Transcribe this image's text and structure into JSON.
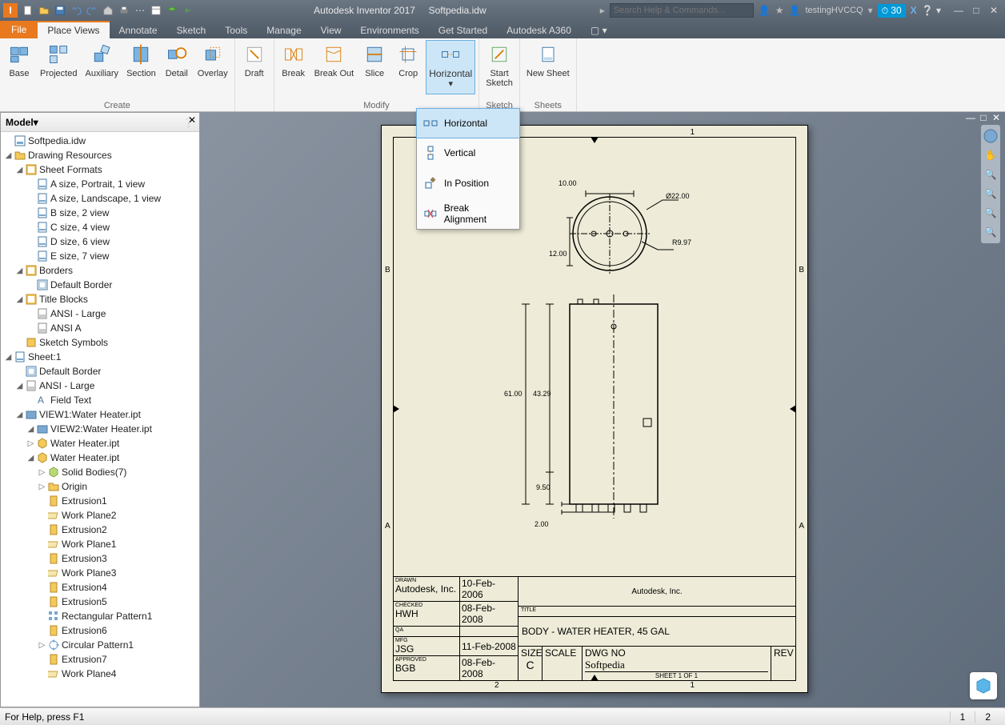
{
  "app": {
    "title": "Autodesk Inventor 2017",
    "doc": "Softpedia.idw"
  },
  "search_placeholder": "Search Help & Commands...",
  "user": "testingHVCCQ",
  "badge": "30",
  "menus": {
    "file": "File",
    "place_views": "Place Views",
    "annotate": "Annotate",
    "sketch": "Sketch",
    "tools": "Tools",
    "manage": "Manage",
    "view": "View",
    "environments": "Environments",
    "get_started": "Get Started",
    "a360": "Autodesk A360"
  },
  "ribbon": {
    "create": {
      "label": "Create",
      "base": "Base",
      "projected": "Projected",
      "auxiliary": "Auxiliary",
      "section": "Section",
      "detail": "Detail",
      "overlay": "Overlay",
      "draft": "Draft"
    },
    "modify": {
      "label": "Modify",
      "break": "Break",
      "break_out": "Break Out",
      "slice": "Slice",
      "crop": "Crop",
      "horizontal": "Horizontal"
    },
    "sketch": {
      "label": "Sketch",
      "start": "Start\nSketch"
    },
    "sheets": {
      "label": "Sheets",
      "new": "New Sheet"
    }
  },
  "dropdown": {
    "horizontal": "Horizontal",
    "vertical": "Vertical",
    "in_position": "In Position",
    "break_alignment": "Break Alignment"
  },
  "model": {
    "title": "Model"
  },
  "tree": [
    {
      "l": 0,
      "t": "",
      "i": "idw",
      "txt": "Softpedia.idw"
    },
    {
      "l": 0,
      "t": "▢",
      "i": "fld",
      "txt": "Drawing Resources"
    },
    {
      "l": 1,
      "t": "▢",
      "i": "shf",
      "txt": "Sheet Formats"
    },
    {
      "l": 2,
      "t": "",
      "i": "sht",
      "txt": "A size, Portrait, 1 view"
    },
    {
      "l": 2,
      "t": "",
      "i": "sht",
      "txt": "A size, Landscape, 1 view"
    },
    {
      "l": 2,
      "t": "",
      "i": "sht",
      "txt": "B size, 2 view"
    },
    {
      "l": 2,
      "t": "",
      "i": "sht",
      "txt": "C size, 4 view"
    },
    {
      "l": 2,
      "t": "",
      "i": "sht",
      "txt": "D size, 6 view"
    },
    {
      "l": 2,
      "t": "",
      "i": "sht",
      "txt": "E size, 7 view"
    },
    {
      "l": 1,
      "t": "▢",
      "i": "shf",
      "txt": "Borders"
    },
    {
      "l": 2,
      "t": "",
      "i": "brd",
      "txt": "Default Border"
    },
    {
      "l": 1,
      "t": "▢",
      "i": "shf",
      "txt": "Title Blocks"
    },
    {
      "l": 2,
      "t": "",
      "i": "ttl",
      "txt": "ANSI - Large"
    },
    {
      "l": 2,
      "t": "",
      "i": "ttl",
      "txt": "ANSI A"
    },
    {
      "l": 1,
      "t": "",
      "i": "sks",
      "txt": "Sketch Symbols"
    },
    {
      "l": 0,
      "t": "▢",
      "i": "sht",
      "txt": "Sheet:1"
    },
    {
      "l": 1,
      "t": "",
      "i": "brd",
      "txt": "Default Border"
    },
    {
      "l": 1,
      "t": "▢",
      "i": "ttl",
      "txt": "ANSI - Large"
    },
    {
      "l": 2,
      "t": "",
      "i": "fld2",
      "txt": "Field Text"
    },
    {
      "l": 1,
      "t": "▢",
      "i": "view",
      "txt": "VIEW1:Water Heater.ipt"
    },
    {
      "l": 2,
      "t": "▢",
      "i": "view",
      "txt": "VIEW2:Water Heater.ipt"
    },
    {
      "l": 2,
      "t": "▹",
      "i": "prt",
      "txt": "Water Heater.ipt"
    },
    {
      "l": 2,
      "t": "▢",
      "i": "prt",
      "txt": "Water Heater.ipt"
    },
    {
      "l": 3,
      "t": "▹",
      "i": "sol",
      "txt": "Solid Bodies(7)"
    },
    {
      "l": 3,
      "t": "▹",
      "i": "fld",
      "txt": "Origin"
    },
    {
      "l": 3,
      "t": "",
      "i": "ext",
      "txt": "Extrusion1"
    },
    {
      "l": 3,
      "t": "",
      "i": "wpl",
      "txt": "Work Plane2"
    },
    {
      "l": 3,
      "t": "",
      "i": "ext",
      "txt": "Extrusion2"
    },
    {
      "l": 3,
      "t": "",
      "i": "wpl",
      "txt": "Work Plane1"
    },
    {
      "l": 3,
      "t": "",
      "i": "ext",
      "txt": "Extrusion3"
    },
    {
      "l": 3,
      "t": "",
      "i": "wpl",
      "txt": "Work Plane3"
    },
    {
      "l": 3,
      "t": "",
      "i": "ext",
      "txt": "Extrusion4"
    },
    {
      "l": 3,
      "t": "",
      "i": "ext",
      "txt": "Extrusion5"
    },
    {
      "l": 3,
      "t": "",
      "i": "pat",
      "txt": "Rectangular Pattern1"
    },
    {
      "l": 3,
      "t": "",
      "i": "ext",
      "txt": "Extrusion6"
    },
    {
      "l": 3,
      "t": "▹",
      "i": "cpt",
      "txt": "Circular Pattern1"
    },
    {
      "l": 3,
      "t": "",
      "i": "ext",
      "txt": "Extrusion7"
    },
    {
      "l": 3,
      "t": "",
      "i": "wpl",
      "txt": "Work Plane4"
    }
  ],
  "drawing": {
    "dims": {
      "d1": "10.00",
      "d2": "Ø22.00",
      "d3": "R9.97",
      "d4": "12.00",
      "d5": "61.00",
      "d6": "43.29",
      "d7": "9.50",
      "d8": "2.00"
    },
    "labels": {
      "a": "A",
      "b": "B",
      "g1": "1",
      "g2": "2"
    },
    "tb": {
      "drawn": "DRAWN",
      "drawn_by": "Autodesk, Inc.",
      "drawn_dt": "10-Feb-2006",
      "checked": "CHECKED",
      "checked_by": "HWH",
      "checked_dt": "08-Feb-2008",
      "qa": "QA",
      "mfg": "MFG",
      "mfg_by": "JSG",
      "mfg_dt": "11-Feb-2008",
      "approved": "APPROVED",
      "approved_by": "BGB",
      "approved_dt": "08-Feb-2008",
      "company": "Autodesk, Inc.",
      "title_lbl": "TITLE",
      "title": "BODY - WATER HEATER, 45 GAL",
      "size_lbl": "SIZE",
      "size": "C",
      "scale_lbl": "SCALE",
      "dwg_lbl": "DWG NO",
      "dwg": "Softpedia",
      "rev_lbl": "REV",
      "sheet": "SHEET 1  OF  1"
    }
  },
  "status": {
    "help": "For Help, press F1",
    "t1": "1",
    "t2": "2"
  }
}
